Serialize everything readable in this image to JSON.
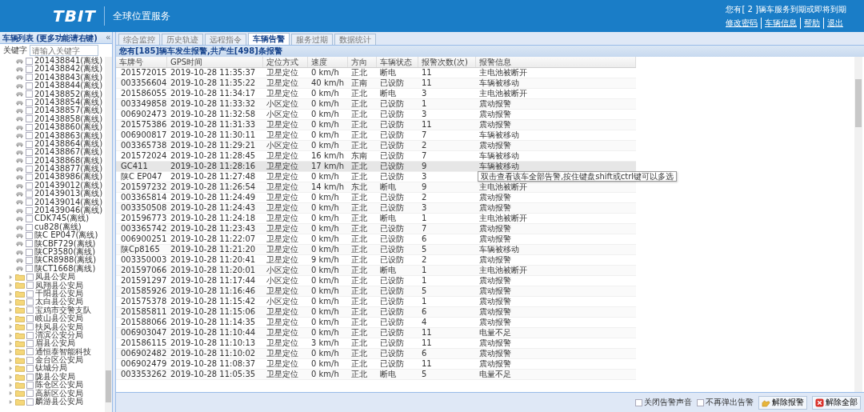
{
  "header": {
    "logo": "TBIT",
    "service": "全球位置服务",
    "notice": "您有[ 2 ]辆车服务到期或即将到期",
    "links": [
      "修改密码",
      "车辆信息",
      "帮助",
      "退出"
    ]
  },
  "sidebar": {
    "title": "车辆列表 (更多功能请右键)",
    "collapse": "«",
    "keyword_label": "关键字",
    "keyword_placeholder": "请输入关键字",
    "tree": [
      {
        "kind": "vehicle",
        "label": "201438841(离线)",
        "checked": false
      },
      {
        "kind": "vehicle",
        "label": "201438842(离线)",
        "checked": false
      },
      {
        "kind": "vehicle",
        "label": "201438843(离线)",
        "checked": false
      },
      {
        "kind": "vehicle",
        "label": "201438844(离线)",
        "checked": false
      },
      {
        "kind": "vehicle",
        "label": "201438852(离线)",
        "checked": false
      },
      {
        "kind": "vehicle",
        "label": "201438854(离线)",
        "checked": false
      },
      {
        "kind": "vehicle",
        "label": "201438857(离线)",
        "checked": false
      },
      {
        "kind": "vehicle",
        "label": "201438858(离线)",
        "checked": false
      },
      {
        "kind": "vehicle",
        "label": "201438860(离线)",
        "checked": false
      },
      {
        "kind": "vehicle",
        "label": "201438863(离线)",
        "checked": false
      },
      {
        "kind": "vehicle",
        "label": "201438864(离线)",
        "checked": false
      },
      {
        "kind": "vehicle",
        "label": "201438867(离线)",
        "checked": false
      },
      {
        "kind": "vehicle",
        "label": "201438868(离线)",
        "checked": false
      },
      {
        "kind": "vehicle",
        "label": "201438877(离线)",
        "checked": false
      },
      {
        "kind": "vehicle",
        "label": "201438986(离线)",
        "checked": false
      },
      {
        "kind": "vehicle",
        "label": "201439012(离线)",
        "checked": false
      },
      {
        "kind": "vehicle",
        "label": "201439013(离线)",
        "checked": false
      },
      {
        "kind": "vehicle",
        "label": "201439014(离线)",
        "checked": false
      },
      {
        "kind": "vehicle",
        "label": "201439046(离线)",
        "checked": false
      },
      {
        "kind": "vehicle",
        "label": "CDK745(离线)",
        "checked": false
      },
      {
        "kind": "vehicle",
        "label": "cu828(离线)",
        "checked": false
      },
      {
        "kind": "vehicle",
        "label": "陕C EP047(离线)",
        "checked": false
      },
      {
        "kind": "vehicle",
        "label": "陕CBF729(离线)",
        "checked": false
      },
      {
        "kind": "vehicle",
        "label": "陕CP3580(离线)",
        "checked": false
      },
      {
        "kind": "vehicle",
        "label": "陕CR8988(离线)",
        "checked": false
      },
      {
        "kind": "vehicle",
        "label": "陕CT1668(离线)",
        "checked": false
      },
      {
        "kind": "group",
        "label": "凤县公安局",
        "checked": false,
        "expanded": false
      },
      {
        "kind": "group",
        "label": "凤翔县公安局",
        "checked": false,
        "expanded": false
      },
      {
        "kind": "group",
        "label": "千阳县公安局",
        "checked": false,
        "expanded": false
      },
      {
        "kind": "group",
        "label": "太白县公安局",
        "checked": false,
        "expanded": false
      },
      {
        "kind": "group",
        "label": "宝鸡市交警支队",
        "checked": false,
        "expanded": false
      },
      {
        "kind": "group",
        "label": "岐山县公安局",
        "checked": false,
        "expanded": false
      },
      {
        "kind": "group",
        "label": "扶风县公安局",
        "checked": false,
        "expanded": false
      },
      {
        "kind": "group",
        "label": "渭滨公安分局",
        "checked": false,
        "expanded": false
      },
      {
        "kind": "group",
        "label": "眉县公安局",
        "checked": false,
        "expanded": false
      },
      {
        "kind": "group",
        "label": "通恒泰智能科技",
        "checked": false,
        "expanded": false
      },
      {
        "kind": "group",
        "label": "金台区公安局",
        "checked": false,
        "expanded": false
      },
      {
        "kind": "group",
        "label": "钛城分局",
        "checked": false,
        "expanded": false
      },
      {
        "kind": "group",
        "label": "陇县公安局",
        "checked": false,
        "expanded": false
      },
      {
        "kind": "group",
        "label": "陈仓区公安局",
        "checked": false,
        "expanded": false
      },
      {
        "kind": "group",
        "label": "高新区公安局",
        "checked": false,
        "expanded": false
      },
      {
        "kind": "group",
        "label": "麟游县公安局",
        "checked": false,
        "expanded": false
      }
    ]
  },
  "tabs": [
    {
      "label": "综合监控",
      "selected": false
    },
    {
      "label": "历史轨迹",
      "selected": false
    },
    {
      "label": "远程指令",
      "selected": false
    },
    {
      "label": "车辆告警",
      "selected": true
    },
    {
      "label": "服务过期",
      "selected": false
    },
    {
      "label": "数据统计",
      "selected": false
    }
  ],
  "summary": "您有[185]辆车发生报警,共产生[498]条报警",
  "table": {
    "columns": [
      "车牌号",
      "GPS时间",
      "定位方式",
      "速度",
      "方向",
      "车辆状态",
      "报警次数(次)",
      "报警信息"
    ],
    "rows": [
      {
        "selected": false,
        "cells": [
          "201572015",
          "2019-10-28 11:35:37",
          "卫星定位",
          "0 km/h",
          "正北",
          "断电",
          "11",
          "主电池被断开"
        ]
      },
      {
        "selected": false,
        "cells": [
          "003356604",
          "2019-10-28 11:35:22",
          "卫星定位",
          "40 km/h",
          "正南",
          "已设防",
          "11",
          "车辆被移动"
        ]
      },
      {
        "selected": false,
        "cells": [
          "201586055",
          "2019-10-28 11:34:17",
          "卫星定位",
          "0 km/h",
          "正北",
          "断电",
          "3",
          "主电池被断开"
        ]
      },
      {
        "selected": false,
        "cells": [
          "003349858",
          "2019-10-28 11:33:32",
          "小区定位",
          "0 km/h",
          "正北",
          "已设防",
          "1",
          "震动报警"
        ]
      },
      {
        "selected": false,
        "cells": [
          "006902473",
          "2019-10-28 11:32:58",
          "小区定位",
          "0 km/h",
          "正北",
          "已设防",
          "3",
          "震动报警"
        ]
      },
      {
        "selected": false,
        "cells": [
          "201575386",
          "2019-10-28 11:31:33",
          "卫星定位",
          "0 km/h",
          "正北",
          "已设防",
          "11",
          "震动报警"
        ]
      },
      {
        "selected": false,
        "cells": [
          "006900817",
          "2019-10-28 11:30:11",
          "卫星定位",
          "0 km/h",
          "正北",
          "已设防",
          "7",
          "车辆被移动"
        ]
      },
      {
        "selected": false,
        "cells": [
          "003365738",
          "2019-10-28 11:29:21",
          "小区定位",
          "0 km/h",
          "正北",
          "已设防",
          "2",
          "震动报警"
        ]
      },
      {
        "selected": false,
        "cells": [
          "201572024",
          "2019-10-28 11:28:45",
          "卫星定位",
          "16 km/h",
          "东南",
          "已设防",
          "7",
          "车辆被移动"
        ]
      },
      {
        "selected": true,
        "cells": [
          "GC411",
          "2019-10-28 11:28:16",
          "卫星定位",
          "17 km/h",
          "正北",
          "已设防",
          "9",
          "车辆被移动"
        ]
      },
      {
        "selected": false,
        "cells": [
          "陕C EP047",
          "2019-10-28 11:27:48",
          "卫星定位",
          "0 km/h",
          "正北",
          "已设防",
          "3"
        ]
      },
      {
        "selected": false,
        "cells": [
          "201597232",
          "2019-10-28 11:26:54",
          "卫星定位",
          "14 km/h",
          "东北",
          "断电",
          "9",
          "主电池被断开"
        ]
      },
      {
        "selected": false,
        "cells": [
          "003365814",
          "2019-10-28 11:24:49",
          "卫星定位",
          "0 km/h",
          "正北",
          "已设防",
          "2",
          "震动报警"
        ]
      },
      {
        "selected": false,
        "cells": [
          "003350508",
          "2019-10-28 11:24:43",
          "卫星定位",
          "0 km/h",
          "正北",
          "已设防",
          "3",
          "震动报警"
        ]
      },
      {
        "selected": false,
        "cells": [
          "201596773",
          "2019-10-28 11:24:18",
          "卫星定位",
          "0 km/h",
          "正北",
          "断电",
          "1",
          "主电池被断开"
        ]
      },
      {
        "selected": false,
        "cells": [
          "003365742",
          "2019-10-28 11:23:43",
          "卫星定位",
          "0 km/h",
          "正北",
          "已设防",
          "7",
          "震动报警"
        ]
      },
      {
        "selected": false,
        "cells": [
          "006900251",
          "2019-10-28 11:22:07",
          "卫星定位",
          "0 km/h",
          "正北",
          "已设防",
          "6",
          "震动报警"
        ]
      },
      {
        "selected": false,
        "cells": [
          "陕Cp8165",
          "2019-10-28 11:21:20",
          "卫星定位",
          "0 km/h",
          "正北",
          "已设防",
          "5",
          "车辆被移动"
        ]
      },
      {
        "selected": false,
        "cells": [
          "003350003",
          "2019-10-28 11:20:41",
          "卫星定位",
          "9 km/h",
          "正北",
          "已设防",
          "2",
          "震动报警"
        ]
      },
      {
        "selected": false,
        "cells": [
          "201597066",
          "2019-10-28 11:20:01",
          "小区定位",
          "0 km/h",
          "正北",
          "断电",
          "1",
          "主电池被断开"
        ]
      },
      {
        "selected": false,
        "cells": [
          "201591297",
          "2019-10-28 11:17:44",
          "小区定位",
          "0 km/h",
          "正北",
          "已设防",
          "1",
          "震动报警"
        ]
      },
      {
        "selected": false,
        "cells": [
          "201585926",
          "2019-10-28 11:16:46",
          "卫星定位",
          "0 km/h",
          "正北",
          "已设防",
          "5",
          "震动报警"
        ]
      },
      {
        "selected": false,
        "cells": [
          "201575378",
          "2019-10-28 11:15:42",
          "小区定位",
          "0 km/h",
          "正北",
          "已设防",
          "1",
          "震动报警"
        ]
      },
      {
        "selected": false,
        "cells": [
          "201585811",
          "2019-10-28 11:15:06",
          "卫星定位",
          "0 km/h",
          "正北",
          "已设防",
          "6",
          "震动报警"
        ]
      },
      {
        "selected": false,
        "cells": [
          "201588066",
          "2019-10-28 11:14:35",
          "卫星定位",
          "0 km/h",
          "正北",
          "已设防",
          "4",
          "震动报警"
        ]
      },
      {
        "selected": false,
        "cells": [
          "006903047",
          "2019-10-28 11:10:44",
          "卫星定位",
          "0 km/h",
          "正北",
          "已设防",
          "11",
          "电量不足"
        ]
      },
      {
        "selected": false,
        "cells": [
          "201586115",
          "2019-10-28 11:10:13",
          "卫星定位",
          "3 km/h",
          "正北",
          "已设防",
          "11",
          "震动报警"
        ]
      },
      {
        "selected": false,
        "cells": [
          "006902482",
          "2019-10-28 11:10:02",
          "卫星定位",
          "0 km/h",
          "正北",
          "已设防",
          "6",
          "震动报警"
        ]
      },
      {
        "selected": false,
        "cells": [
          "006902479",
          "2019-10-28 11:08:37",
          "卫星定位",
          "0 km/h",
          "正北",
          "已设防",
          "11",
          "震动报警"
        ]
      },
      {
        "selected": false,
        "cells": [
          "003353262",
          "2019-10-28 11:05:35",
          "卫星定位",
          "0 km/h",
          "正北",
          "断电",
          "5",
          "电量不足"
        ]
      }
    ]
  },
  "tooltip": "双击查看该车全部告警,按住键盘shift或ctrl键可以多选",
  "footer": {
    "options": [
      {
        "label": "关闭告警声音",
        "checked": false
      },
      {
        "label": "不再弹出告警",
        "checked": false
      }
    ],
    "buttons": [
      {
        "kind": "dismiss",
        "label": "解除报警"
      },
      {
        "kind": "dismiss_all",
        "label": "解除全部"
      }
    ]
  }
}
